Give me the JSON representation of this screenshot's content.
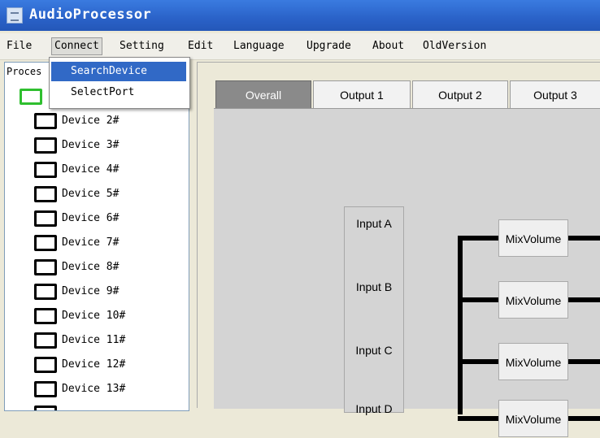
{
  "app": {
    "title": "AudioProcessor"
  },
  "menu": [
    "File",
    "Connect",
    "Setting",
    "Edit",
    "Language",
    "Upgrade",
    "About",
    "OldVersion"
  ],
  "connect_menu": {
    "options": [
      "SearchDevice",
      "SelectPort"
    ]
  },
  "left_panel": {
    "header": "Proces",
    "devices": [
      "Device 2#",
      "Device 3#",
      "Device 4#",
      "Device 5#",
      "Device 6#",
      "Device 7#",
      "Device 8#",
      "Device 9#",
      "Device 10#",
      "Device 11#",
      "Device 12#",
      "Device 13#"
    ]
  },
  "tabs": [
    "Overall",
    "Output 1",
    "Output 2",
    "Output 3"
  ],
  "overall": {
    "inputs": [
      "Input A",
      "Input B",
      "Input C",
      "Input D"
    ],
    "mix_label": "MixVolume"
  },
  "colors": {
    "title_bar": "#2a62c8",
    "menu_highlight": "#3169c6",
    "selected_device_icon": "#2fbf2f",
    "selected_tab": "#8a8a8a"
  }
}
